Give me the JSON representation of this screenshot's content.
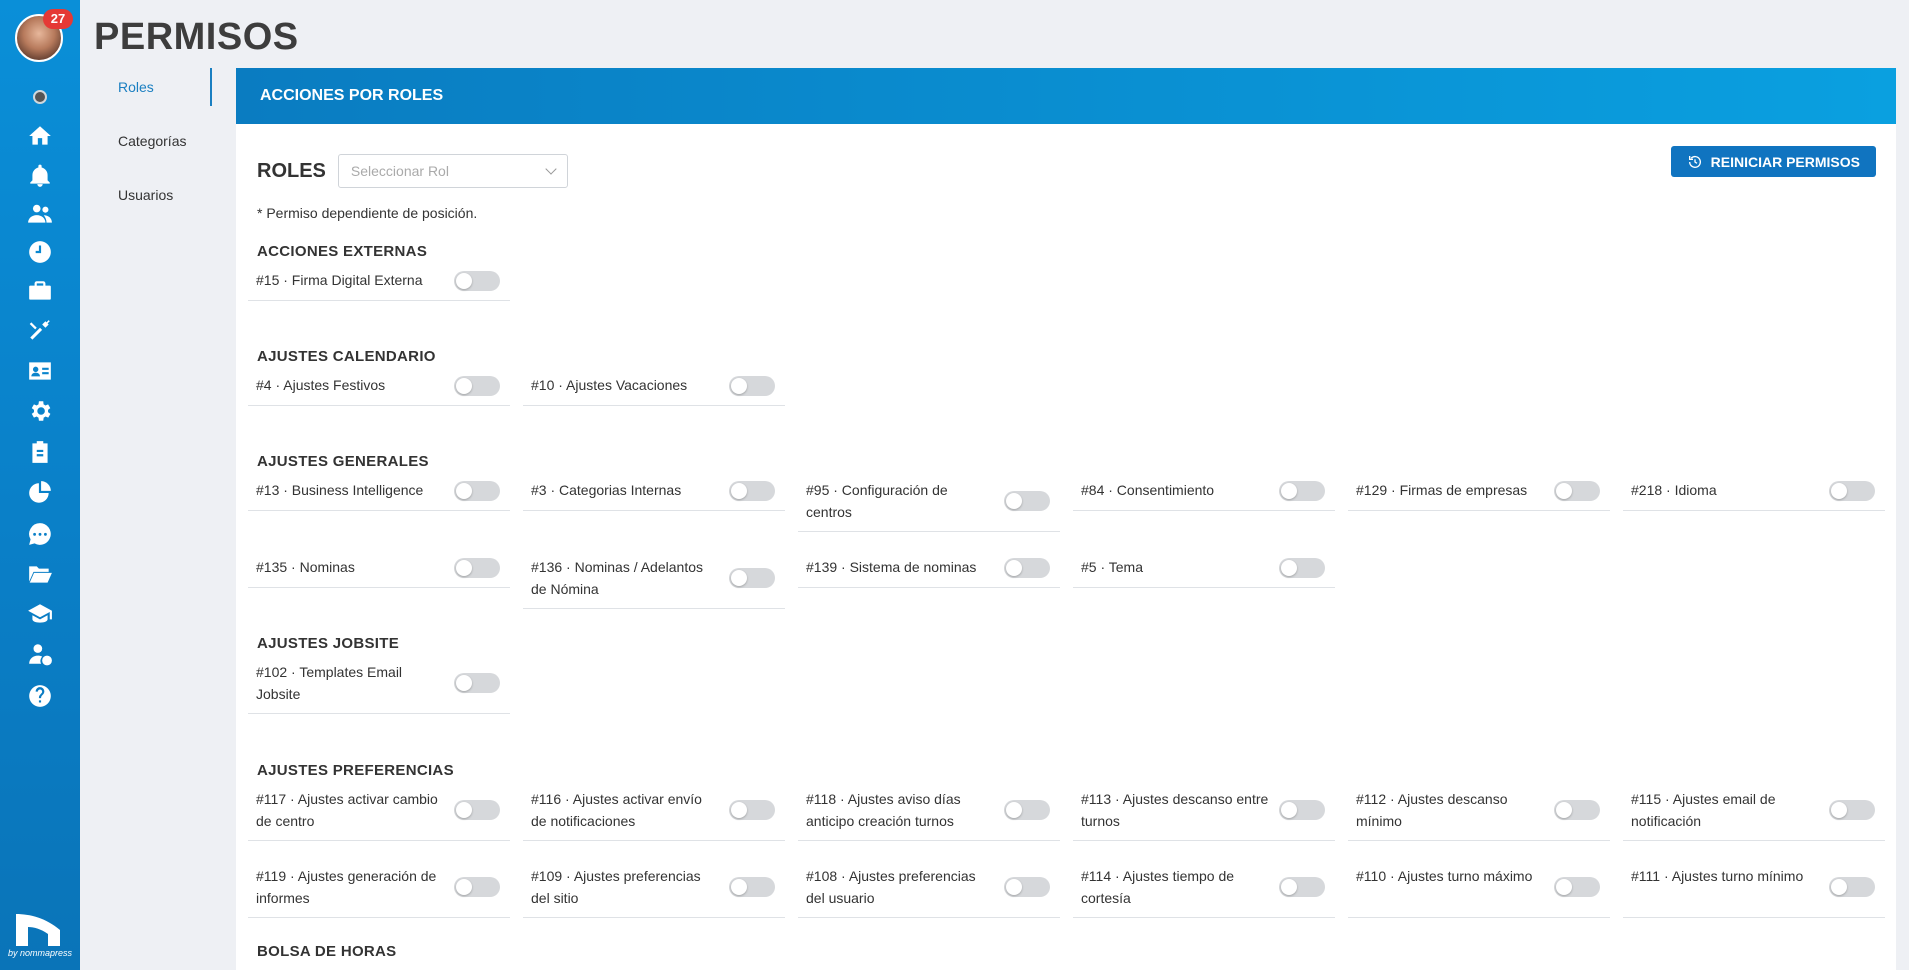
{
  "app": {
    "notifications_count": "27",
    "brand_by": "by nommapress"
  },
  "page": {
    "title": "PERMISOS"
  },
  "subnav": {
    "items": [
      {
        "label": "Roles",
        "active": true
      },
      {
        "label": "Categorías",
        "active": false
      },
      {
        "label": "Usuarios",
        "active": false
      }
    ]
  },
  "panel": {
    "header": "ACCIONES POR ROLES",
    "roles_label": "ROLES",
    "role_select_placeholder": "Seleccionar Rol",
    "reset_button": "REINICIAR PERMISOS",
    "note": "* Permiso dependiente de posición."
  },
  "sections": [
    {
      "title": "ACCIONES EXTERNAS",
      "permissions": [
        "#15 · Firma Digital Externa"
      ]
    },
    {
      "title": "AJUSTES CALENDARIO",
      "permissions": [
        "#4 · Ajustes Festivos",
        "#10 · Ajustes Vacaciones"
      ]
    },
    {
      "title": "AJUSTES GENERALES",
      "permissions": [
        "#13 · Business Intelligence",
        "#3 · Categorias Internas",
        "#95 · Configuración de centros",
        "#84 · Consentimiento",
        "#129 · Firmas de empresas",
        "#218 · Idioma",
        "#135 · Nominas",
        "#136 · Nominas / Adelantos de Nómina",
        "#139 · Sistema de nominas",
        "#5 · Tema"
      ]
    },
    {
      "title": "AJUSTES JOBSITE",
      "permissions": [
        "#102 · Templates Email Jobsite"
      ]
    },
    {
      "title": "AJUSTES PREFERENCIAS",
      "permissions": [
        "#117 · Ajustes activar cambio de centro",
        "#116 · Ajustes activar envío de notificaciones",
        "#118 · Ajustes aviso días anticipo creación turnos",
        "#113 · Ajustes descanso entre turnos",
        "#112 · Ajustes descanso mínimo",
        "#115 · Ajustes email de notificación",
        "#119 · Ajustes generación de informes",
        "#109 · Ajustes preferencias del sitio",
        "#108 · Ajustes preferencias del usuario",
        "#114 · Ajustes tiempo de cortesía",
        "#110 · Ajustes turno máximo",
        "#111 · Ajustes turno mínimo"
      ]
    },
    {
      "title": "BOLSA DE HORAS",
      "permissions": []
    }
  ],
  "colors": {
    "sidebar": "#0a8fd8",
    "header_gradient_start": "#0a7cc1",
    "header_gradient_end": "#0aa0e0",
    "button": "#1074c0",
    "badge": "#e53935",
    "toggle_off": "#d6d8db"
  },
  "toggles_state": "all-off",
  "sidebar_icons": [
    "home-icon",
    "bell-icon",
    "users-icon",
    "clock-icon",
    "briefcase-icon",
    "tools-icon",
    "id-card-icon",
    "gear-icon",
    "clipboard-icon",
    "pie-chart-icon",
    "chat-icon",
    "folder-icon",
    "graduation-cap-icon",
    "user-dollar-icon",
    "help-icon"
  ]
}
